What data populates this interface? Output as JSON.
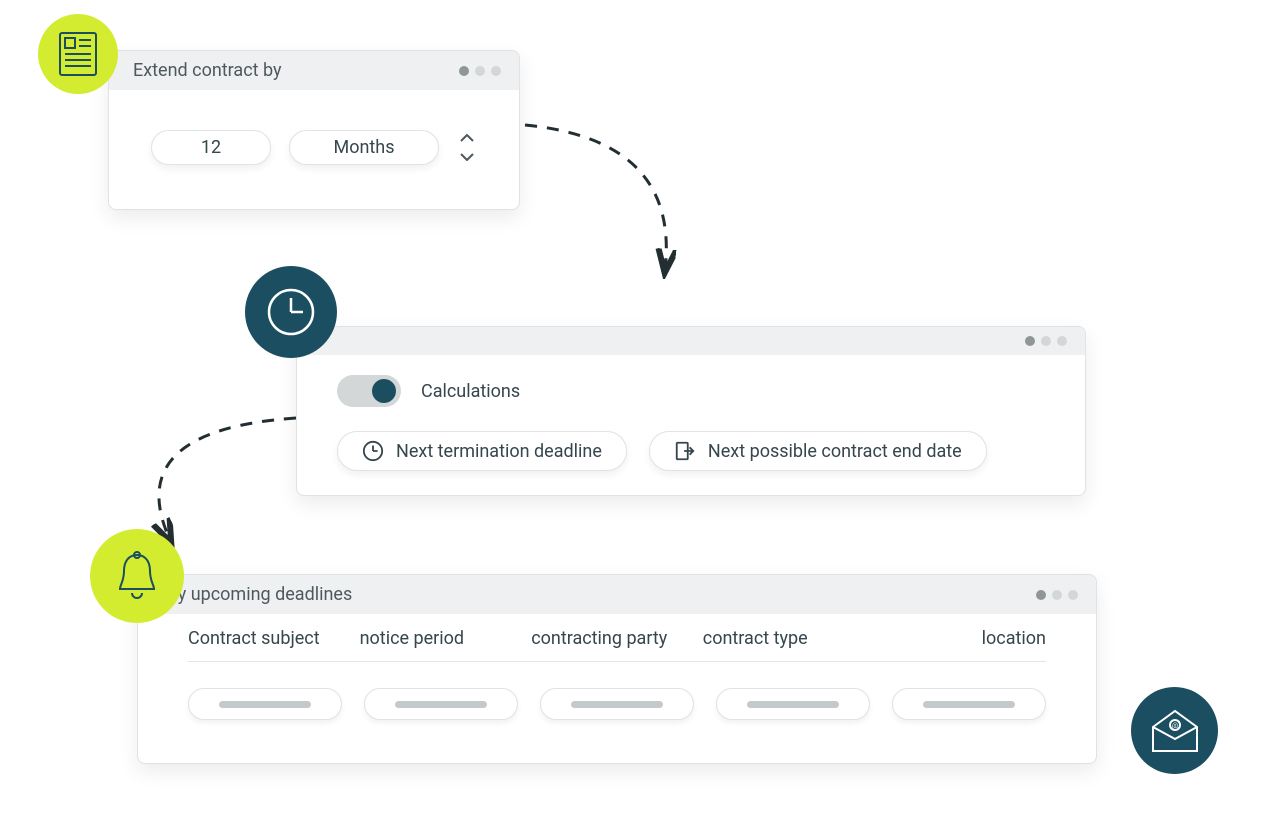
{
  "extend": {
    "title": "Extend contract by",
    "value": "12",
    "unit": "Months"
  },
  "calculations": {
    "toggle_label": "Calculations",
    "chips": {
      "termination": "Next termination deadline",
      "end_date": "Next possible contract end date"
    }
  },
  "deadlines": {
    "title": "My upcoming deadlines",
    "columns": {
      "subject": "Contract subject",
      "notice": "notice period",
      "party": "contracting party",
      "type": "contract type",
      "location": "location"
    }
  },
  "colors": {
    "lime": "#d3ec2f",
    "teal": "#1b4e60"
  }
}
